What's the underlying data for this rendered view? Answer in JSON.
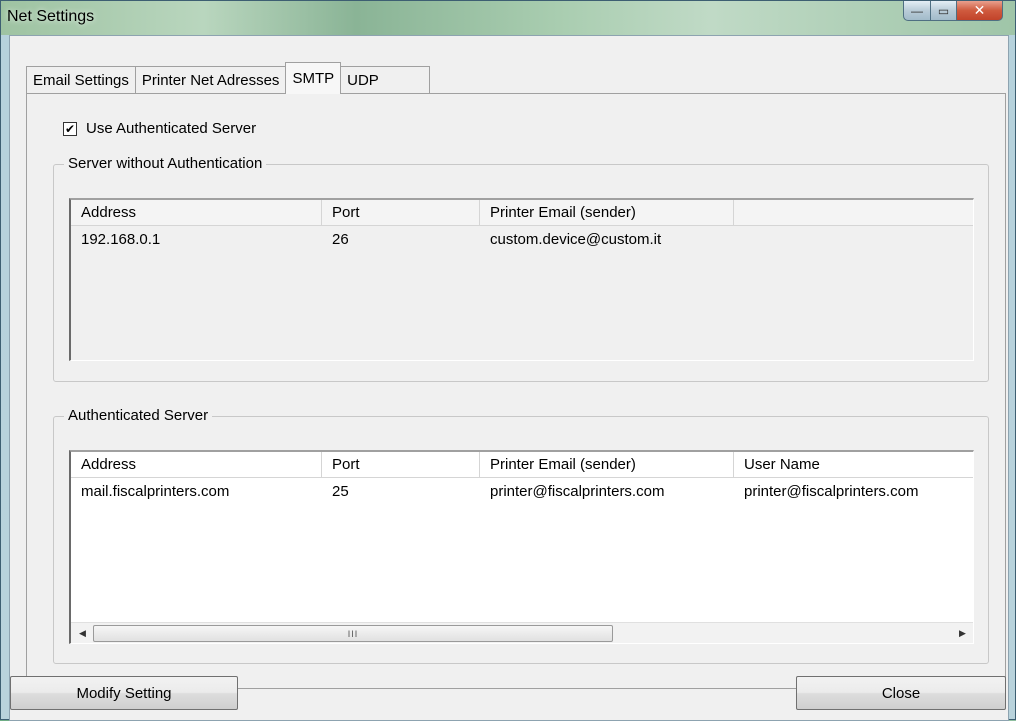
{
  "window": {
    "title": "Net Settings"
  },
  "tabs": [
    {
      "label": "Email Settings"
    },
    {
      "label": "Printer Net Adresses"
    },
    {
      "label": "SMTP"
    },
    {
      "label": "UDP"
    }
  ],
  "active_tab": "SMTP",
  "use_authenticated": {
    "label": "Use Authenticated Server",
    "checked": true,
    "mark": "✔"
  },
  "no_auth_group": {
    "label": "Server without Authentication",
    "columns": [
      "Address",
      "Port",
      "Printer Email (sender)"
    ],
    "rows": [
      [
        "192.168.0.1",
        "26",
        "custom.device@custom.it"
      ]
    ]
  },
  "auth_group": {
    "label": "Authenticated Server",
    "columns": [
      "Address",
      "Port",
      "Printer Email (sender)",
      "User Name"
    ],
    "rows": [
      [
        "mail.fiscalprinters.com",
        "25",
        "printer@fiscalprinters.com",
        "printer@fiscalprinters.com"
      ]
    ],
    "scroll_thumb_grip": "III"
  },
  "buttons": {
    "modify": "Modify Setting",
    "close": "Close"
  },
  "icons": {
    "minimize": "—",
    "maximize": "▭",
    "close": "✕",
    "scroll_left": "◀",
    "scroll_right": "▶"
  }
}
